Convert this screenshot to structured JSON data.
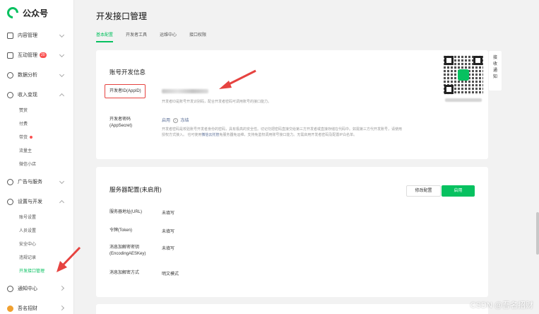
{
  "brand": {
    "name": "公众号"
  },
  "sidebar": {
    "groups": [
      {
        "label": "内容管理"
      },
      {
        "label": "互动管理",
        "badge": "20"
      },
      {
        "label": "数据分析"
      },
      {
        "label": "收入变现",
        "items": [
          "赞赏",
          "付费",
          "带货",
          "流量主",
          "微信小店"
        ]
      },
      {
        "label": "广告与服务"
      },
      {
        "label": "设置与开发",
        "items": [
          "账号设置",
          "人员设置",
          "安全中心",
          "违规记录",
          "开发接口管理"
        ]
      },
      {
        "label": "通知中心"
      },
      {
        "label": "吾名招财"
      }
    ]
  },
  "main": {
    "title": "开发接口管理",
    "tabs": [
      "基本配置",
      "开发者工具",
      "运维中心",
      "接口权限"
    ],
    "account_section": {
      "title": "账号开发信息",
      "appid_label": "开发者ID(AppID)",
      "appid_desc": "开发者ID是账号开发识别码，配合开发者密码可调用账号的接口能力。",
      "secret_label": "开发者密码(AppSecret)",
      "secret_action1": "启用",
      "secret_action2": "冻结",
      "secret_desc_1": "开发者密码是校验账号开发者身份的密码，具有极高的安全性。切记勿把密码直接交给第三方开发者或直接存储在代码中。如需第三方代开发账号，请使用",
      "secret_desc_2a": "授权方式接入。 也可使用",
      "secret_desc_link": "微信云托管",
      "secret_desc_2b": "免服务器免运维，支持免鉴权调用账号接口能力。无需启用开发者密码及配置IP白名单。"
    },
    "server_section": {
      "title": "服务器配置(未启用)",
      "edit_label": "修改配置",
      "enable_label": "启用",
      "fields": [
        {
          "label": "服务器地址(URL)",
          "value": "未填写"
        },
        {
          "label": "令牌(Token)",
          "value": "未填写"
        },
        {
          "label": "消息加解密密钥\n(EncodingAESKey)",
          "value": "未填写"
        },
        {
          "label": "消息加解密方式",
          "value": "明文模式"
        }
      ]
    }
  },
  "qr_widget": {
    "receive_label": "接收通知"
  },
  "watermark": "CSDN @吾名招财",
  "colors": {
    "accent": "#07c160",
    "danger": "#e64340",
    "link": "#576b95"
  }
}
